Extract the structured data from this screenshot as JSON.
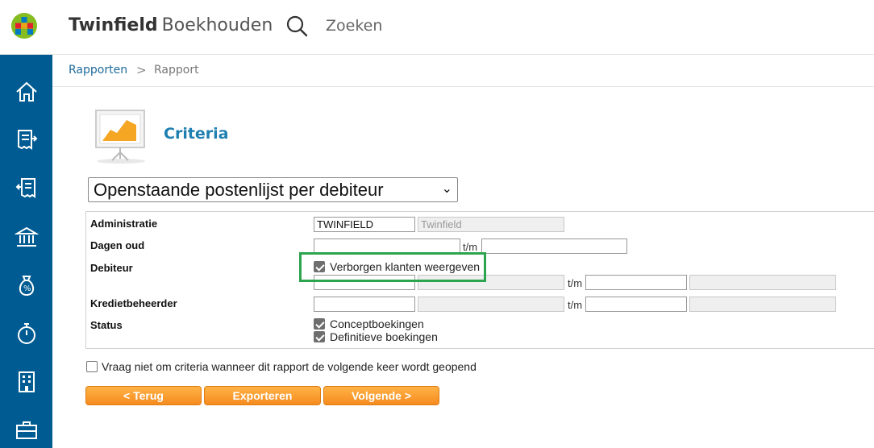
{
  "header": {
    "brand_bold": "Twinfield",
    "brand_light": "Boekhouden",
    "search_placeholder": "Zoeken"
  },
  "sidebar": {
    "items": [
      {
        "icon": "home-icon"
      },
      {
        "icon": "invoice-icon"
      },
      {
        "icon": "purchase-invoice-icon"
      },
      {
        "icon": "bank-icon"
      },
      {
        "icon": "money-bag-icon"
      },
      {
        "icon": "stopwatch-icon"
      },
      {
        "icon": "building-icon"
      },
      {
        "icon": "briefcase-icon"
      }
    ]
  },
  "breadcrumb": {
    "link": "Rapporten",
    "separator": ">",
    "current": "Rapport"
  },
  "criteria": {
    "title": "Criteria",
    "report_selected": "Openstaande postenlijst per debiteur"
  },
  "form": {
    "administratie": {
      "label": "Administratie",
      "code": "TWINFIELD",
      "name": "Twinfield"
    },
    "dagen_oud": {
      "label": "Dagen oud",
      "from": "",
      "to": "",
      "tm": "t/m"
    },
    "debiteur": {
      "label": "Debiteur",
      "show_hidden_label": "Verborgen klanten weergeven",
      "show_hidden_checked": true,
      "from": "",
      "to": "",
      "tm": "t/m"
    },
    "kredietbeheerder": {
      "label": "Kredietbeheerder",
      "from": "",
      "to": "",
      "tm": "t/m"
    },
    "status": {
      "label": "Status",
      "concept_label": "Conceptboekingen",
      "concept_checked": true,
      "definitive_label": "Definitieve boekingen",
      "definitive_checked": true
    }
  },
  "dont_ask": {
    "label": "Vraag niet om criteria wanneer dit rapport de volgende keer wordt geopend",
    "checked": false
  },
  "buttons": {
    "back": "< Terug",
    "export": "Exporteren",
    "next": "Volgende >"
  },
  "colors": {
    "sidebar": "#005b92",
    "accent": "#1e7fb0",
    "button": "#f68b1f",
    "highlight": "#2da44e"
  }
}
